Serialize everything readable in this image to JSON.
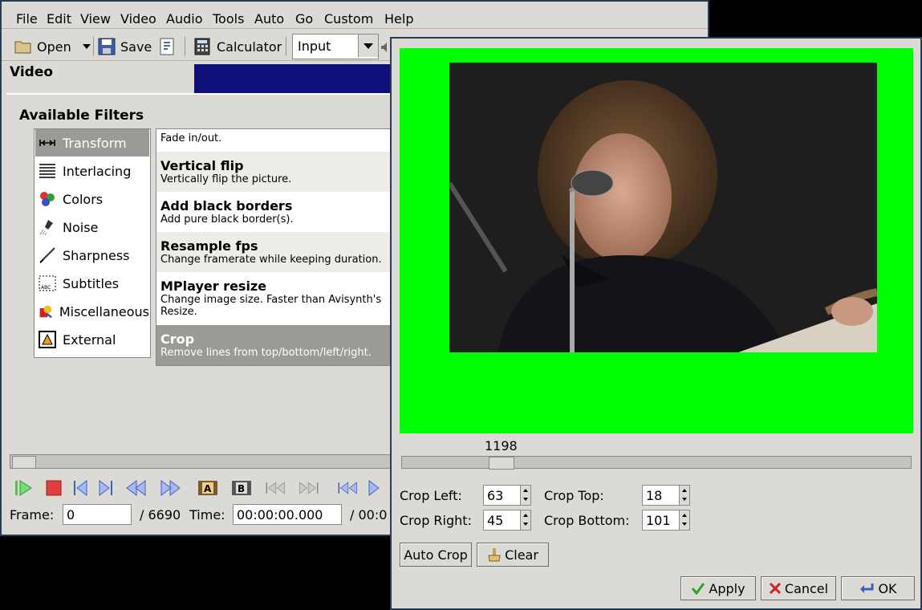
{
  "menu": {
    "file": "File",
    "edit": "Edit",
    "view": "View",
    "video": "Video",
    "audio": "Audio",
    "tools": "Tools",
    "auto": "Auto",
    "go": "Go",
    "custom": "Custom",
    "help": "Help"
  },
  "toolbar": {
    "open": "Open",
    "save": "Save",
    "calculator": "Calculator",
    "input_value": "Input"
  },
  "main": {
    "video_section": "Video"
  },
  "filters": {
    "title": "Available Filters",
    "categories": [
      {
        "label": "Transform",
        "icon": "transform-icon"
      },
      {
        "label": "Interlacing",
        "icon": "interlacing-icon"
      },
      {
        "label": "Colors",
        "icon": "colors-icon"
      },
      {
        "label": "Noise",
        "icon": "noise-icon"
      },
      {
        "label": "Sharpness",
        "icon": "sharpness-icon"
      },
      {
        "label": "Subtitles",
        "icon": "subtitles-icon"
      },
      {
        "label": "Miscellaneous",
        "icon": "miscellaneous-icon"
      },
      {
        "label": "External",
        "icon": "external-icon"
      }
    ],
    "items": [
      {
        "name": "",
        "desc": "Fade in/out."
      },
      {
        "name": "Vertical flip",
        "desc": "Vertically flip the picture."
      },
      {
        "name": "Add black borders",
        "desc": "Add pure black border(s)."
      },
      {
        "name": "Resample fps",
        "desc": "Change framerate while keeping duration."
      },
      {
        "name": "MPlayer resize",
        "desc": "Change image size. Faster than Avisynth's Resize."
      },
      {
        "name": "Crop",
        "desc": "Remove lines from top/bottom/left/right."
      }
    ]
  },
  "status": {
    "frame_label": "Frame:",
    "frame_value": "0",
    "total_frames": "/ 6690",
    "time_label": "Time:",
    "time_value": "00:00:00.000",
    "total_time_partial": "/ 00:0"
  },
  "preview": {
    "frame_number": "1198",
    "crop_left_label": "Crop Left:",
    "crop_left": "63",
    "crop_right_label": "Crop Right:",
    "crop_right": "45",
    "crop_top_label": "Crop Top:",
    "crop_top": "18",
    "crop_bottom_label": "Crop Bottom:",
    "crop_bottom": "101",
    "auto_crop": "Auto Crop",
    "clear": "Clear",
    "apply": "Apply",
    "cancel": "Cancel",
    "ok": "OK"
  },
  "colors": {
    "preview_bg": "#00ff00",
    "video_blue": "#10107a",
    "selected": "#9c9a94"
  }
}
